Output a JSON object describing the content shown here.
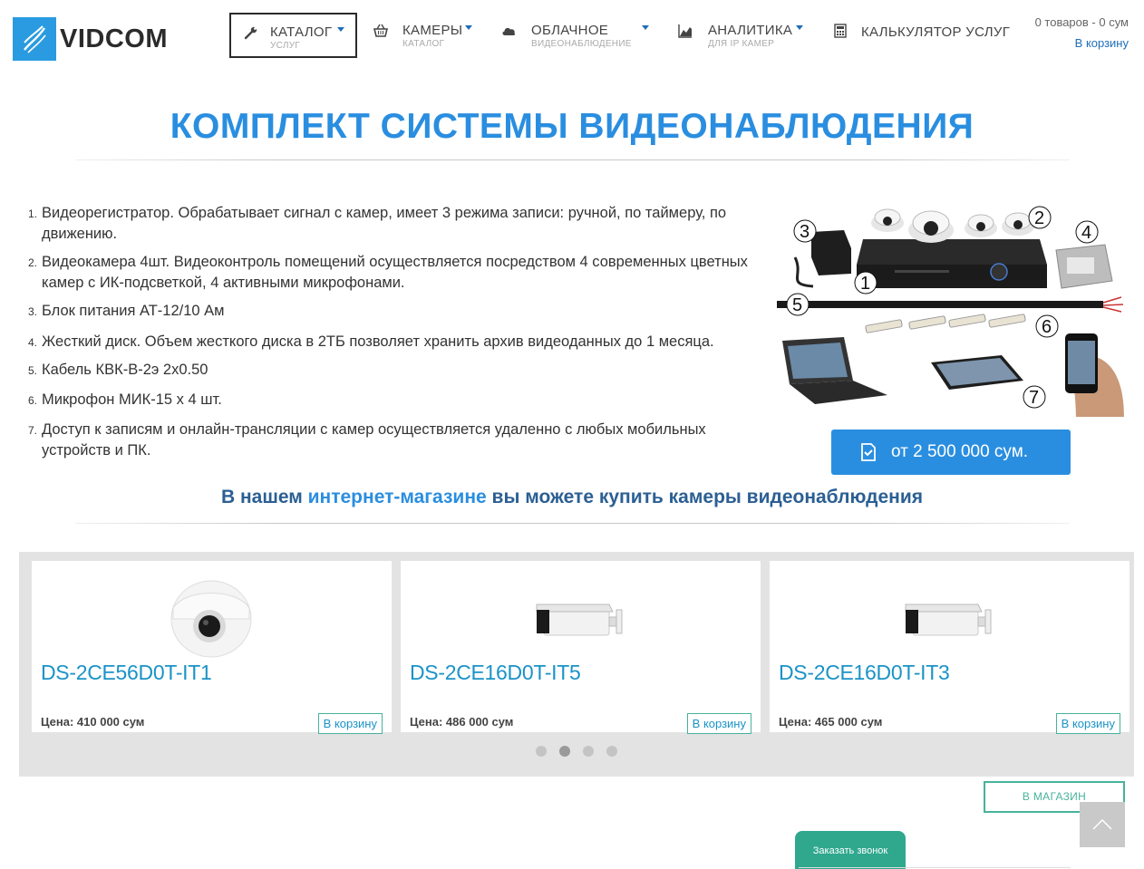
{
  "brand": {
    "name": "VIDCOM",
    "color": "#2a9be0"
  },
  "nav": [
    {
      "label": "КАТАЛОГ",
      "sub": "УСЛУГ",
      "icon": "wrench-icon",
      "dropdown": true,
      "active": true
    },
    {
      "label": "КАМЕРЫ",
      "sub": "КАТАЛОГ",
      "icon": "basket-icon",
      "dropdown": true
    },
    {
      "label": "ОБЛАЧНОЕ",
      "sub": "ВИДЕОНАБЛЮДЕНИЕ",
      "icon": "cloud-icon",
      "dropdown": true
    },
    {
      "label": "АНАЛИТИКА",
      "sub": "ДЛЯ IP КАМЕР",
      "icon": "chart-icon",
      "dropdown": true
    },
    {
      "label": "КАЛЬКУЛЯТОР УСЛУГ",
      "sub": "",
      "icon": "calculator-icon",
      "dropdown": false
    }
  ],
  "cart": {
    "summary": "0  товаров - 0 сум",
    "link": "В корзину"
  },
  "title": "КОМПЛЕКТ СИСТЕМЫ ВИДЕОНАБЛЮДЕНИЯ",
  "features": [
    {
      "num": "1.",
      "text": "Видеорегистратор. Обрабатывает  сигнал с камер, имеет 3 режима записи: ручной, по таймеру, по движению."
    },
    {
      "num": "2.",
      "text": "Видеокамера  4шт. Видеоконтроль помещений осуществляется посредством 4 современных цветных  камер с ИК-подсветкой, 4 активными микрофонами."
    },
    {
      "num": "3.",
      "text": "Блок питания АТ-12/10 Ам"
    },
    {
      "num": "4.",
      "text": "Жесткий диск. Объем жесткого диска в 2ТБ позволяет хранить архив видеоданных до 1 месяца."
    },
    {
      "num": "5.",
      "text": "Кабель КВК-В-2э 2х0.50"
    },
    {
      "num": "6.",
      "text": "Микрофон МИК-15 х 4 шт."
    },
    {
      "num": "7.",
      "text": "Доступ к записям и онлайн-трансляции с камер осуществляется удаленно с любых мобильных устройств и ПК."
    }
  ],
  "kit_labels": [
    "1",
    "2",
    "3",
    "4",
    "5",
    "6",
    "7"
  ],
  "price_button": "от 2 500 000 сум.",
  "shop_line": {
    "pre": "В нашем ",
    "link": "интернет-магазине",
    "post": " вы можете купить камеры видеонаблюдения"
  },
  "products": [
    {
      "name": "DS-2CE56D0T-IT1",
      "price": "Цена: 410 000 сум",
      "button": "В корзину",
      "type": "dome"
    },
    {
      "name": "DS-2CE16D0T-IT5",
      "price": "Цена: 486 000 сум",
      "button": "В корзину",
      "type": "bullet"
    },
    {
      "name": "DS-2CE16D0T-IT3",
      "price": "Цена: 465 000 сум",
      "button": "В корзину",
      "type": "bullet"
    }
  ],
  "carousel": {
    "pages": 4,
    "active_page": 2
  },
  "shop_button": "В МАГАЗИН",
  "call_button": "Заказать звонок",
  "colors": {
    "accent": "#2a8ee0",
    "teal": "#47b39b",
    "link": "#1a93c7"
  }
}
